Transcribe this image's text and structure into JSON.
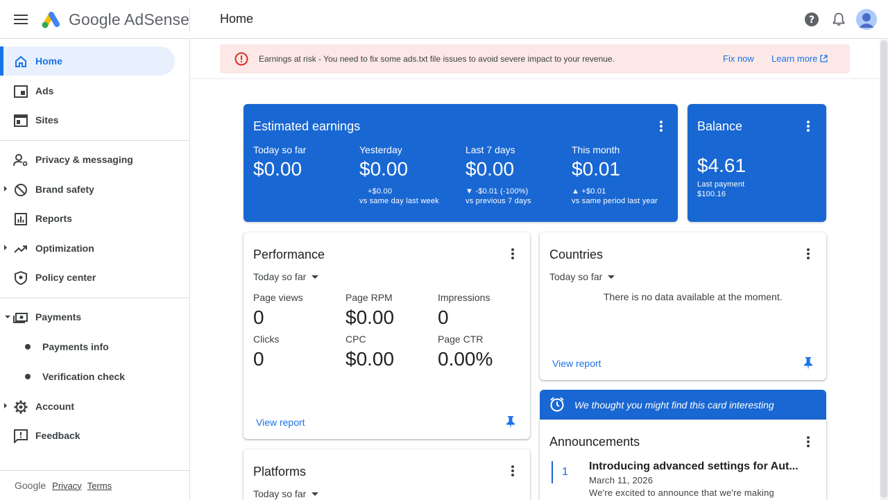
{
  "app": {
    "logo_text": "Google AdSense",
    "page_title": "Home"
  },
  "colors": {
    "accent": "#1a73e8",
    "card_blue": "#1967d2",
    "alert_bg": "#fce8e6",
    "alert_icon": "#d93025"
  },
  "sidebar": {
    "items": [
      {
        "label": "Home",
        "icon": "home-icon"
      },
      {
        "label": "Ads",
        "icon": "ads-icon"
      },
      {
        "label": "Sites",
        "icon": "sites-icon"
      },
      {
        "label": "Privacy & messaging",
        "icon": "privacy-icon"
      },
      {
        "label": "Brand safety",
        "icon": "block-icon"
      },
      {
        "label": "Reports",
        "icon": "reports-icon"
      },
      {
        "label": "Optimization",
        "icon": "trending-icon"
      },
      {
        "label": "Policy center",
        "icon": "shield-icon"
      },
      {
        "label": "Payments",
        "icon": "payments-icon"
      },
      {
        "label": "Payments info"
      },
      {
        "label": "Verification check"
      },
      {
        "label": "Account",
        "icon": "gear-icon"
      },
      {
        "label": "Feedback",
        "icon": "feedback-icon"
      }
    ],
    "footer": {
      "google": "Google",
      "privacy": "Privacy",
      "terms": "Terms"
    }
  },
  "alert": {
    "text": "Earnings at risk - You need to fix some ads.txt file issues to avoid severe impact to your revenue.",
    "fix_now": "Fix now",
    "learn_more": "Learn more"
  },
  "earnings": {
    "title": "Estimated earnings",
    "columns": [
      {
        "label": "Today so far",
        "value": "$0.00",
        "delta": "",
        "compare": ""
      },
      {
        "label": "Yesterday",
        "value": "$0.00",
        "delta": "+$0.00",
        "compare": "vs same day last week"
      },
      {
        "label": "Last 7 days",
        "value": "$0.00",
        "delta": "▼ -$0.01 (-100%)",
        "compare": "vs previous 7 days"
      },
      {
        "label": "This month",
        "value": "$0.01",
        "delta": "▲ +$0.01",
        "compare": "vs same period last year"
      }
    ]
  },
  "balance": {
    "title": "Balance",
    "value": "$4.61",
    "last_payment_label": "Last payment",
    "last_payment_value": "$100.16"
  },
  "performance": {
    "title": "Performance",
    "range": "Today so far",
    "metrics": [
      {
        "label": "Page views",
        "value": "0"
      },
      {
        "label": "Page RPM",
        "value": "$0.00"
      },
      {
        "label": "Impressions",
        "value": "0"
      },
      {
        "label": "Clicks",
        "value": "0"
      },
      {
        "label": "CPC",
        "value": "$0.00"
      },
      {
        "label": "Page CTR",
        "value": "0.00%"
      }
    ],
    "view_report": "View report"
  },
  "countries": {
    "title": "Countries",
    "range": "Today so far",
    "empty_text": "There is no data available at the moment.",
    "view_report": "View report"
  },
  "banner": {
    "text": "We thought you might find this card interesting"
  },
  "announcements": {
    "title": "Announcements",
    "number": "1",
    "item_title": "Introducing advanced settings for Aut...",
    "item_date": "March 11, 2026",
    "item_text": "We're excited to announce that we're making"
  },
  "platforms": {
    "title": "Platforms",
    "range": "Today so far"
  }
}
